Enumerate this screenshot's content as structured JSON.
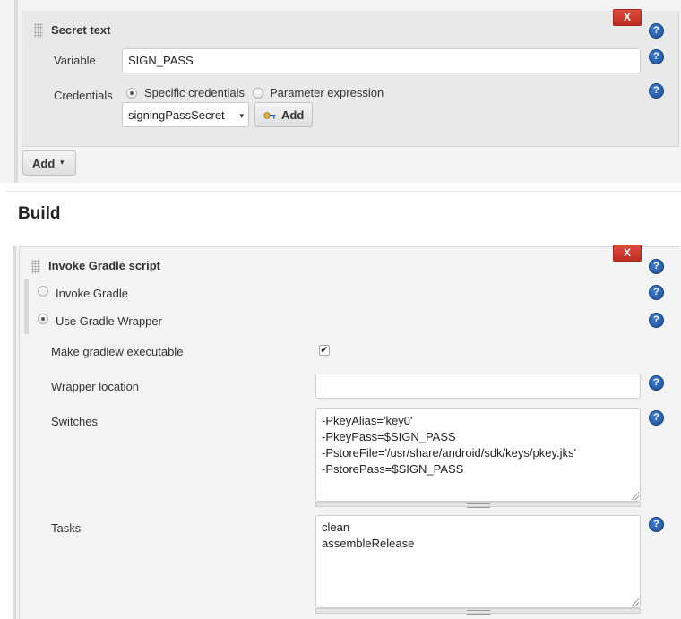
{
  "secret_text": {
    "title": "Secret text",
    "delete_label": "X",
    "variable_label": "Variable",
    "variable_value": "SIGN_PASS",
    "credentials_label": "Credentials",
    "radio_specific": "Specific credentials",
    "radio_parameter": "Parameter expression",
    "selected_credential": "signingPassSecret",
    "add_cred_label": "Add"
  },
  "bindings": {
    "add_label": "Add"
  },
  "build": {
    "heading": "Build",
    "step_title": "Invoke Gradle script",
    "delete_label": "X",
    "radio_invoke_gradle": "Invoke Gradle",
    "radio_use_wrapper": "Use Gradle Wrapper",
    "make_executable_label": "Make gradlew executable",
    "make_executable_checked": true,
    "wrapper_location_label": "Wrapper location",
    "wrapper_location_value": "",
    "switches_label": "Switches",
    "switches_value": "-PkeyAlias='key0'\n-PkeyPass=$SIGN_PASS\n-PstoreFile='/usr/share/android/sdk/keys/pkey.jks'\n-PstorePass=$SIGN_PASS",
    "tasks_label": "Tasks",
    "tasks_value": "clean\nassembleRelease"
  },
  "icons": {
    "help": "?",
    "checkmark": "✔",
    "dropdown": "▾"
  },
  "colors": {
    "delete_button": "#d03a2f",
    "help_icon": "#2a5ea8",
    "panel_bg": "#e9e9e9"
  }
}
